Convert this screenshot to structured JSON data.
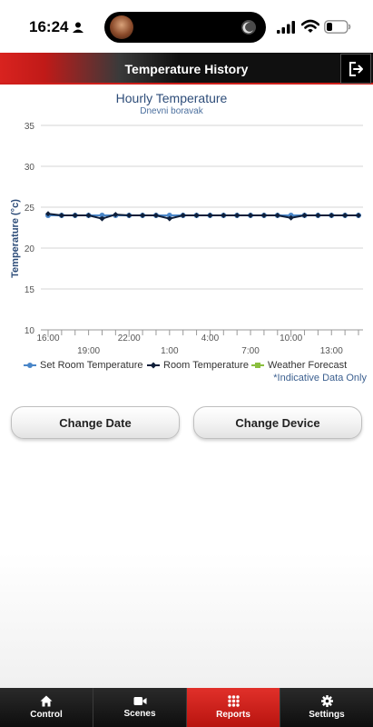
{
  "status_bar": {
    "time": "16:24"
  },
  "header": {
    "title": "Temperature History"
  },
  "chart_data": {
    "type": "line",
    "title": "Hourly Temperature",
    "subtitle": "Dnevni boravak",
    "ylabel": "Temperature (°c)",
    "ylim": [
      10,
      35
    ],
    "yticks": [
      10,
      15,
      20,
      25,
      30,
      35
    ],
    "x_tick_labels_row1": [
      "16:00",
      "22:00",
      "4:00",
      "10:00"
    ],
    "x_tick_labels_row2": [
      "19:00",
      "1:00",
      "7:00",
      "13:00"
    ],
    "grid": true,
    "legend": "bottom",
    "series": [
      {
        "name": "Set Room Temperature",
        "color": "#4a86c8",
        "values": [
          24,
          24,
          24,
          24,
          24,
          24,
          24,
          24,
          24,
          24,
          24,
          24,
          24,
          24,
          24,
          24,
          24,
          24,
          24,
          24,
          24,
          24,
          24,
          24
        ]
      },
      {
        "name": "Room Temperature",
        "color": "#0f1f3a",
        "values": [
          24.2,
          24,
          24,
          24,
          23.6,
          24.1,
          24,
          24,
          24,
          23.6,
          24,
          24,
          24,
          24,
          24,
          24,
          24,
          24,
          23.7,
          24,
          24,
          24,
          24,
          24
        ]
      },
      {
        "name": "Weather Forecast",
        "color": "#8bbf3f",
        "values": []
      }
    ],
    "note": "*Indicative Data Only"
  },
  "buttons": {
    "change_date": "Change Date",
    "change_device": "Change Device"
  },
  "tabs": [
    {
      "label": "Control",
      "icon": "home-icon"
    },
    {
      "label": "Scenes",
      "icon": "video-camera-icon"
    },
    {
      "label": "Reports",
      "icon": "grid-icon",
      "active": true
    },
    {
      "label": "Settings",
      "icon": "gear-icon"
    }
  ]
}
